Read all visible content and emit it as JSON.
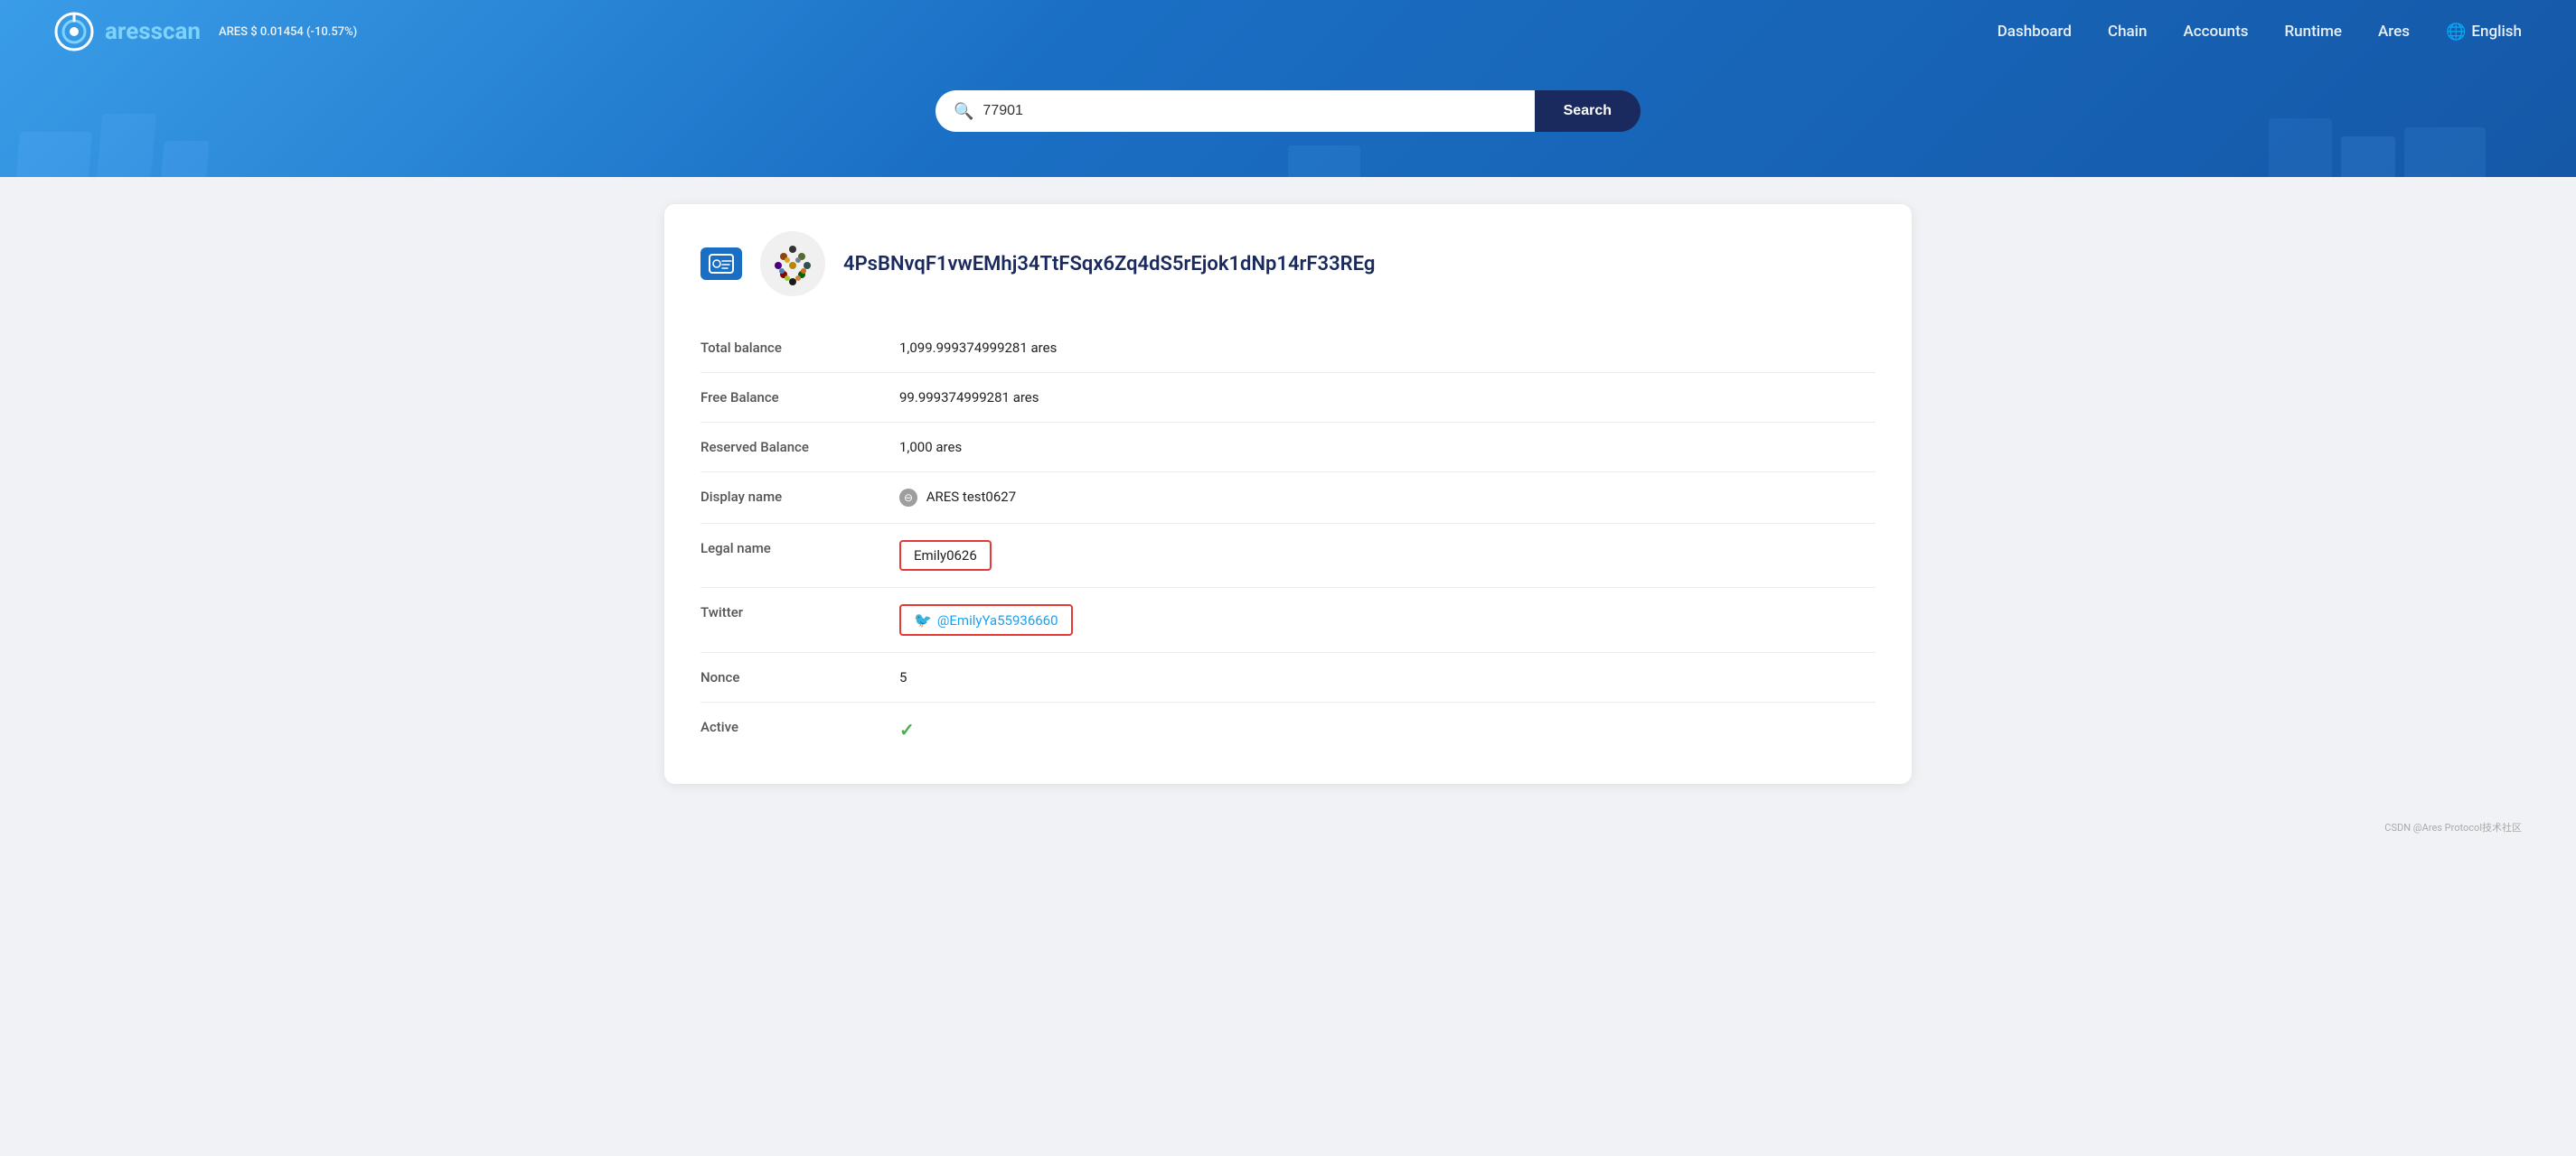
{
  "header": {
    "logo_text_start": "ares",
    "logo_text_highlight": "scan",
    "price": "ARES $ 0.01454 (-10.57%)",
    "nav": {
      "dashboard": "Dashboard",
      "chain": "Chain",
      "accounts": "Accounts",
      "runtime": "Runtime",
      "ares": "Ares",
      "language": "English"
    }
  },
  "search": {
    "placeholder": "Search...",
    "value": "77901",
    "button_label": "Search"
  },
  "account": {
    "address": "4PsBNvqF1vwEMhj34TtFSqx6Zq4dS5rEjok1dNp14rF33REg",
    "fields": {
      "total_balance_label": "Total balance",
      "total_balance_value": "1,099.999374999281 ares",
      "free_balance_label": "Free Balance",
      "free_balance_value": "99.999374999281 ares",
      "reserved_balance_label": "Reserved Balance",
      "reserved_balance_value": "1,000 ares",
      "display_name_label": "Display name",
      "display_name_value": "ARES test0627",
      "legal_name_label": "Legal name",
      "legal_name_value": "Emily0626",
      "twitter_label": "Twitter",
      "twitter_value": "@EmilyYa55936660",
      "nonce_label": "Nonce",
      "nonce_value": "5",
      "active_label": "Active"
    }
  },
  "footer": {
    "note": "CSDN @Ares Protocol技术社区"
  }
}
